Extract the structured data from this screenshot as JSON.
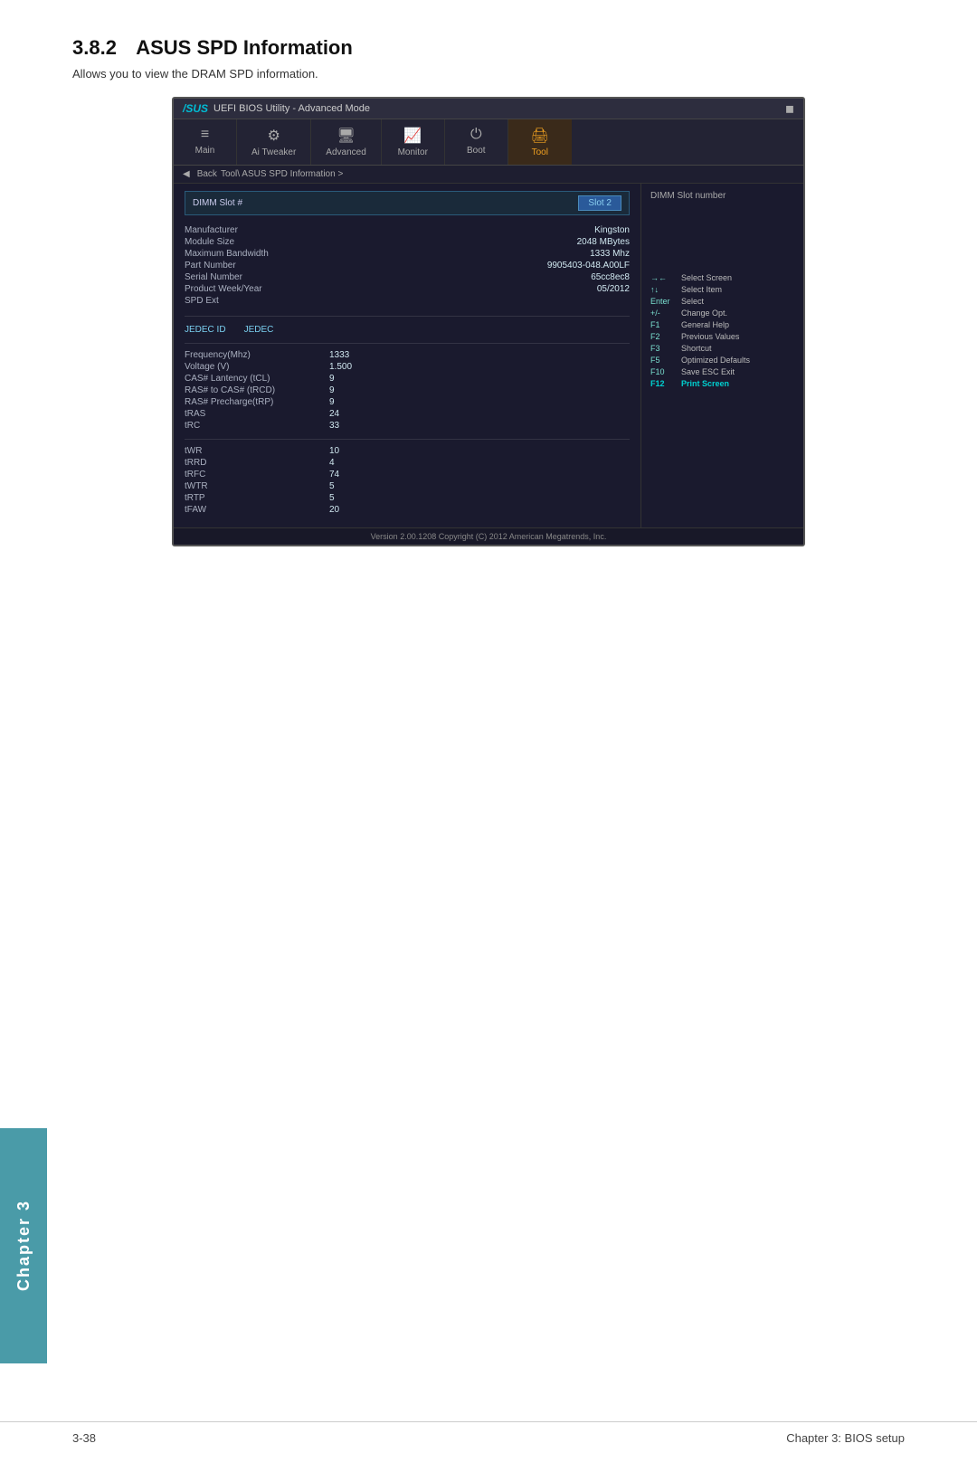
{
  "page": {
    "section_number": "3.8.2",
    "section_title": "ASUS SPD Information",
    "section_description": "Allows you to view the DRAM SPD information.",
    "footer_left": "3-38",
    "footer_right": "Chapter 3: BIOS setup",
    "chapter_label": "Chapter 3"
  },
  "bios": {
    "titlebar": {
      "logo": "/SUS",
      "title": "UEFI BIOS Utility - Advanced Mode",
      "icon": "◼"
    },
    "nav_tabs": [
      {
        "icon": "≡",
        "label": "Main"
      },
      {
        "icon": "🔧",
        "label": "Ai Tweaker"
      },
      {
        "icon": "📋",
        "label": "Advanced"
      },
      {
        "icon": "📊",
        "label": "Monitor"
      },
      {
        "icon": "⏻",
        "label": "Boot"
      },
      {
        "icon": "🖨",
        "label": "Tool"
      }
    ],
    "breadcrumb": {
      "back": "Back",
      "path": "Tool\\ ASUS SPD Information >"
    },
    "dimm_slot": {
      "label": "DIMM Slot #",
      "value": "Slot 2",
      "right_label": "DIMM Slot number"
    },
    "spd_info": [
      {
        "label": "Manufacturer",
        "value": "Kingston"
      },
      {
        "label": "Module Size",
        "value": "2048 MBytes"
      },
      {
        "label": "Maximum Bandwidth",
        "value": "1333 Mhz"
      },
      {
        "label": "Part Number",
        "value": "9905403-048.A00LF"
      },
      {
        "label": "Serial Number",
        "value": "65cc8ec8"
      },
      {
        "label": "Product Week/Year",
        "value": "05/2012"
      },
      {
        "label": "SPD Ext",
        "value": ""
      }
    ],
    "jedec": {
      "header": [
        "JEDEC ID",
        "JEDEC"
      ],
      "timing_rows": [
        {
          "label": "Frequency(Mhz)",
          "value": "1333"
        },
        {
          "label": "Voltage (V)",
          "value": "1.500"
        },
        {
          "label": "CAS# Lantency (tCL)",
          "value": "9"
        },
        {
          "label": "RAS# to CAS# (tRCD)",
          "value": "9"
        },
        {
          "label": "RAS# Precharge(tRP)",
          "value": "9"
        },
        {
          "label": "tRAS",
          "value": "24"
        },
        {
          "label": "tRC",
          "value": "33"
        }
      ],
      "timing_rows2": [
        {
          "label": "tWR",
          "value": "10"
        },
        {
          "label": "tRRD",
          "value": "4"
        },
        {
          "label": "tRFC",
          "value": "74"
        },
        {
          "label": "tWTR",
          "value": "5"
        },
        {
          "label": "tRTP",
          "value": "5"
        },
        {
          "label": "tFAW",
          "value": "20"
        }
      ]
    },
    "shortcuts": [
      {
        "key": "→←",
        "desc": "Select Screen"
      },
      {
        "key": "↑↓",
        "desc": "Select Item"
      },
      {
        "key": "Enter",
        "desc": "Select"
      },
      {
        "key": "+/-",
        "desc": "Change Opt."
      },
      {
        "key": "F1",
        "desc": "General Help"
      },
      {
        "key": "F2",
        "desc": "Previous Values"
      },
      {
        "key": "F3",
        "desc": "Shortcut"
      },
      {
        "key": "F5",
        "desc": "Optimized Defaults"
      },
      {
        "key": "F10",
        "desc": "Save  ESC  Exit"
      },
      {
        "key": "F12",
        "desc": "Print Screen",
        "highlight": true
      }
    ],
    "version": "Version  2.00.1208   Copyright (C) 2012 American Megatrends, Inc."
  }
}
